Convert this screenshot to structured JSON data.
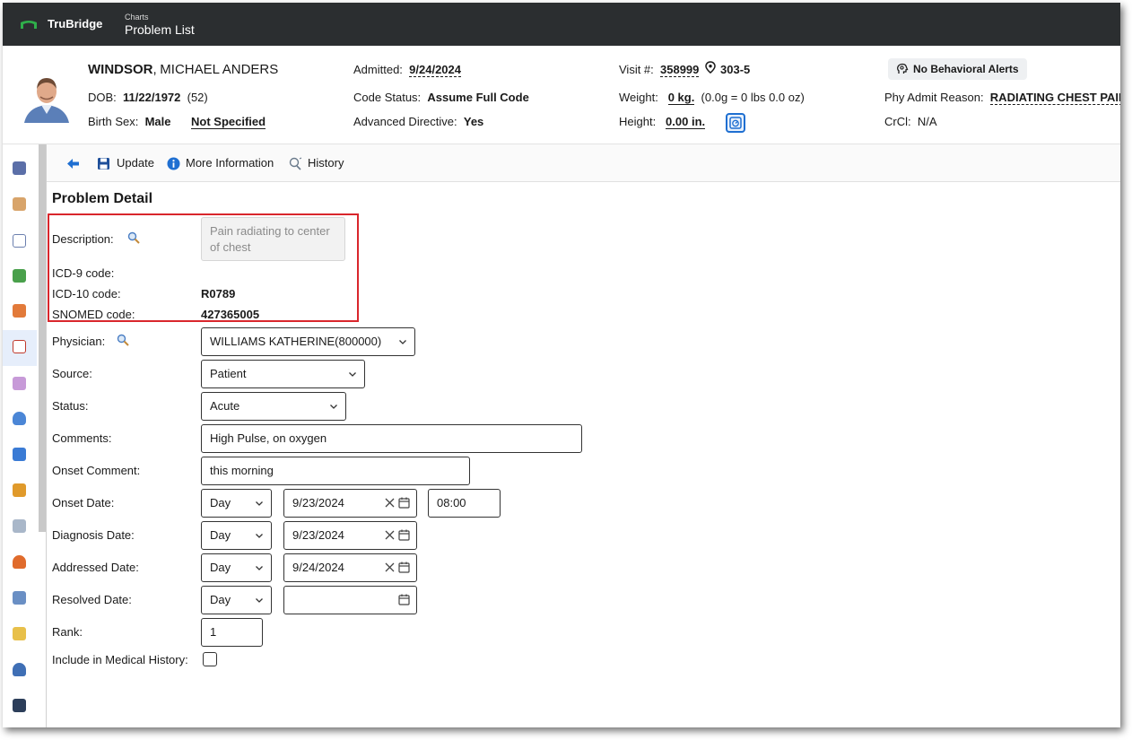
{
  "topbar": {
    "brand": "TruBridge",
    "section": "Charts",
    "page_title": "Problem List"
  },
  "patient": {
    "last_name": "WINDSOR",
    "name_sep": ",",
    "first_name": "MICHAEL ANDERS",
    "dob_label": "DOB:",
    "dob": "11/22/1972",
    "age": "(52)",
    "birth_sex_label": "Birth Sex:",
    "birth_sex": "Male",
    "gender_identity": "Not Specified",
    "admitted_label": "Admitted:",
    "admitted": "9/24/2024",
    "code_status_label": "Code Status:",
    "code_status": "Assume Full Code",
    "adv_directive_label": "Advanced Directive:",
    "adv_directive": "Yes",
    "visit_label": "Visit #:",
    "visit_number": "358999",
    "room": "303-5",
    "weight_label": "Weight:",
    "weight": "0 kg.",
    "weight_detail": "(0.0g = 0 lbs 0.0 oz)",
    "height_label": "Height:",
    "height": "0.00 in.",
    "behavioral_alerts": "No Behavioral Alerts",
    "admit_reason_label": "Phy Admit Reason:",
    "admit_reason": "RADIATING CHEST PAIN",
    "crcl_label": "CrCl:",
    "crcl": "N/A"
  },
  "toolbar": {
    "update": "Update",
    "more_info": "More Information",
    "history": "History"
  },
  "form": {
    "title": "Problem Detail",
    "description_label": "Description:",
    "description": "Pain radiating to center of chest",
    "icd9_label": "ICD-9 code:",
    "icd9": "",
    "icd10_label": "ICD-10 code:",
    "icd10": "R0789",
    "snomed_label": "SNOMED code:",
    "snomed": "427365005",
    "physician_label": "Physician:",
    "physician": "WILLIAMS KATHERINE(800000)",
    "source_label": "Source:",
    "source": "Patient",
    "status_label": "Status:",
    "status": "Acute",
    "comments_label": "Comments:",
    "comments": "High Pulse, on oxygen",
    "onset_comment_label": "Onset Comment:",
    "onset_comment": "this morning",
    "onset_date_label": "Onset Date:",
    "onset_precision": "Day",
    "onset_date": "9/23/2024",
    "onset_time": "08:00",
    "diagnosis_date_label": "Diagnosis Date:",
    "diagnosis_precision": "Day",
    "diagnosis_date": "9/23/2024",
    "addressed_date_label": "Addressed Date:",
    "addressed_precision": "Day",
    "addressed_date": "9/24/2024",
    "resolved_date_label": "Resolved Date:",
    "resolved_precision": "Day",
    "resolved_date": "",
    "rank_label": "Rank:",
    "rank": "1",
    "include_history_label": "Include in Medical History:",
    "include_history": false
  },
  "colors": {
    "topbar": "#2b2e30",
    "brand_green": "#2fae4a",
    "accent_blue": "#1f6fd1",
    "highlight_red": "#d9262c"
  }
}
